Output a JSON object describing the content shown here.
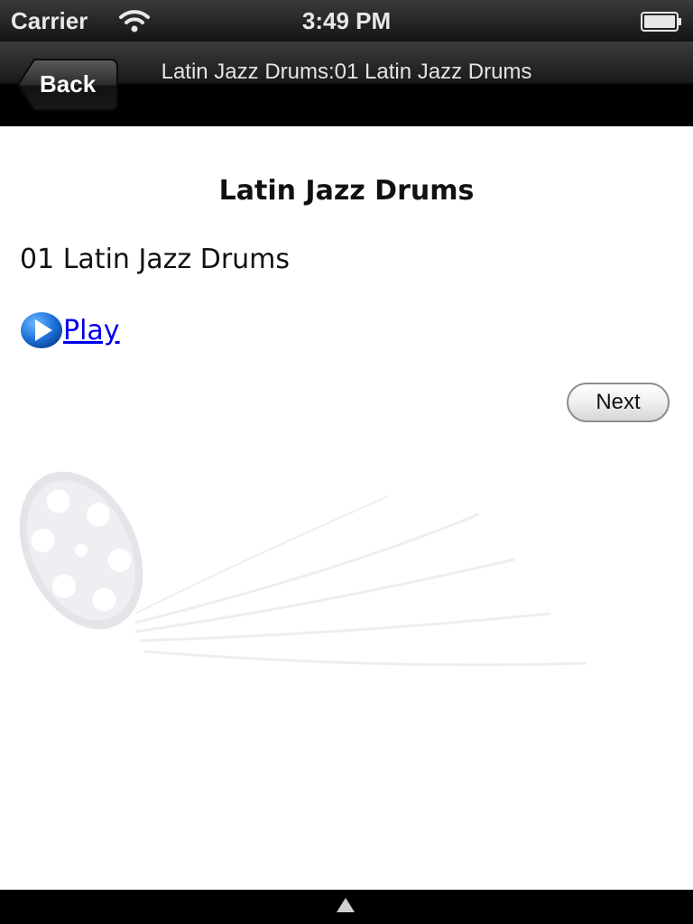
{
  "status_bar": {
    "carrier": "Carrier",
    "time": "3:49 PM",
    "icons": [
      "wifi-icon",
      "battery-icon"
    ]
  },
  "nav_bar": {
    "back_label": "Back",
    "title": "Latin Jazz Drums:01 Latin Jazz Drums"
  },
  "content": {
    "heading": "Latin Jazz Drums",
    "track_title": "01 Latin Jazz Drums",
    "play_label": "Play",
    "next_label": "Next",
    "watermark": "film-reel-icon"
  },
  "bottom_bar": {
    "icon": "up-arrow-icon"
  },
  "colors": {
    "link": "#0000ee",
    "play_icon": "#1a6fd6",
    "bar": "#000000"
  }
}
